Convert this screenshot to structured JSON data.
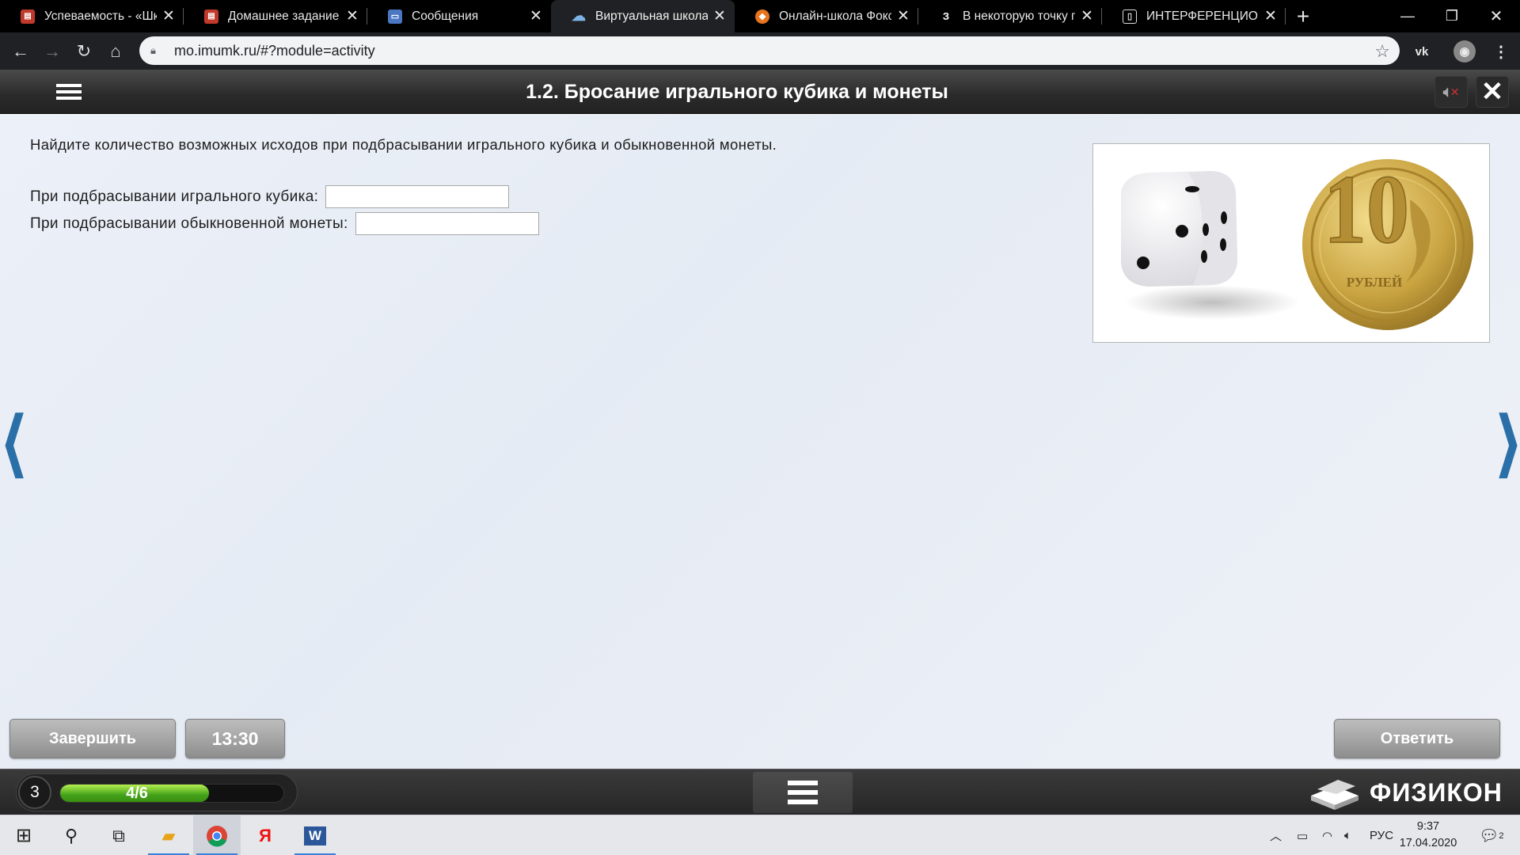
{
  "browser": {
    "tabs": [
      {
        "title": "Успеваемость - «Школ",
        "favicon": "diary-icon",
        "active": false
      },
      {
        "title": "Домашнее задание - «",
        "favicon": "diary-icon",
        "active": false
      },
      {
        "title": "Сообщения",
        "favicon": "chat-icon",
        "active": false
      },
      {
        "title": "Виртуальная школа",
        "favicon": "cloud-icon",
        "active": true
      },
      {
        "title": "Онлайн-школа Фоксф",
        "favicon": "fox-icon",
        "active": false
      },
      {
        "title": "В некоторую точку пр",
        "favicon": "z-icon",
        "favicon_text": "З",
        "active": false
      },
      {
        "title": "ИНТЕРФЕРЕНЦИОННЫ",
        "favicon": "book-icon",
        "active": false
      }
    ],
    "new_tab_label": "+",
    "url": "mo.imumk.ru/#?module=activity"
  },
  "app": {
    "title": "1.2. Бросание игрального кубика и монеты",
    "question": "Найдите количество возможных исходов при подбрасывании игрального кубика и обыкновенной монеты.",
    "fields": [
      {
        "label": "При подбрасывании игрального кубика:",
        "value": ""
      },
      {
        "label": "При подбрасывании обыкновенной монеты:",
        "value": ""
      }
    ],
    "coin_numeral": "10",
    "coin_text": "РУБЛЕЙ",
    "finish_label": "Завершить",
    "timer": "13:30",
    "answer_label": "Ответить",
    "level": "3",
    "progress_text": "4/6",
    "progress_fraction": 0.667,
    "logo_text": "ФИЗИКОН"
  },
  "taskbar": {
    "lang": "РУС",
    "time": "9:37",
    "date": "17.04.2020",
    "notifications": "2"
  },
  "colors": {
    "accent_blue": "#2a6fa8",
    "progress_green": "#43a11a"
  }
}
